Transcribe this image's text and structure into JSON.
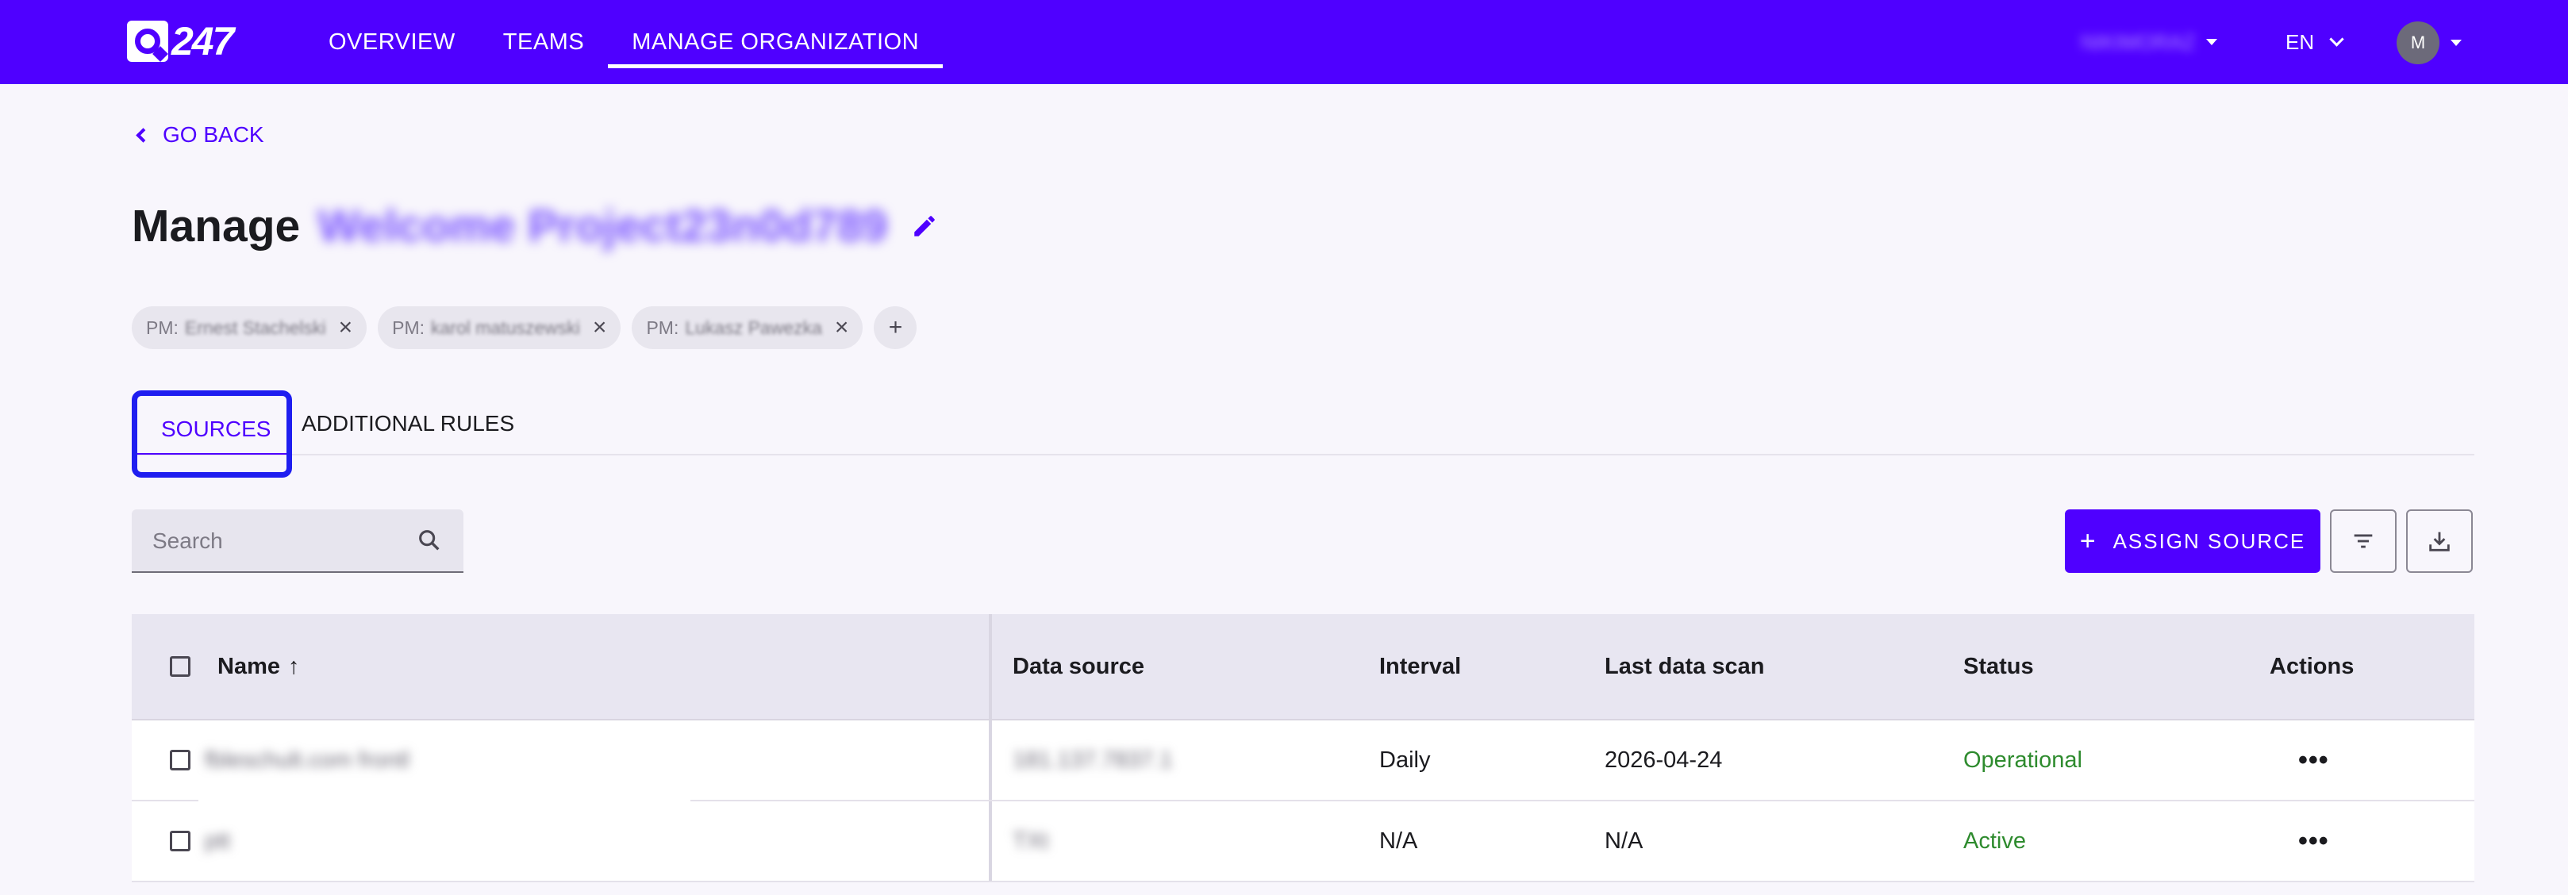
{
  "nav": {
    "logo_text": "247",
    "items": [
      "OVERVIEW",
      "TEAMS",
      "MANAGE ORGANIZATION"
    ],
    "org_name": "NIKIMORAZ",
    "language": "EN",
    "avatar_initial": "M"
  },
  "page": {
    "go_back": "GO BACK",
    "title_prefix": "Manage",
    "project_name": "Welcome Project23n0d789",
    "chips": [
      {
        "prefix": "PM:",
        "name": "Ernest Stachelski"
      },
      {
        "prefix": "PM:",
        "name": "karol matuszewski"
      },
      {
        "prefix": "PM:",
        "name": "Lukasz Pawezka"
      }
    ],
    "add_chip": "+"
  },
  "tabs": [
    "SOURCES",
    "ADDITIONAL RULES"
  ],
  "toolbar": {
    "search_placeholder": "Search",
    "assign_label": "ASSIGN SOURCE",
    "assign_plus": "+"
  },
  "table": {
    "headers": {
      "name": "Name",
      "sort_arrow": "↑",
      "data_source": "Data source",
      "interval": "Interval",
      "last_scan": "Last data scan",
      "status": "Status",
      "actions": "Actions"
    },
    "rows": [
      {
        "name": "fbleschult.com frontl",
        "data_source": "181.137.7837.1",
        "interval": "Daily",
        "last_scan": "2026-04-24",
        "status": "Operational",
        "actions": "•••"
      },
      {
        "name": "ptt",
        "data_source": "TXt",
        "interval": "N/A",
        "last_scan": "N/A",
        "status": "Active",
        "actions": "•••"
      }
    ]
  },
  "colors": {
    "brand": "#4f00ff",
    "status_green": "#2e8b2e",
    "highlight": "#1f1ef0"
  }
}
